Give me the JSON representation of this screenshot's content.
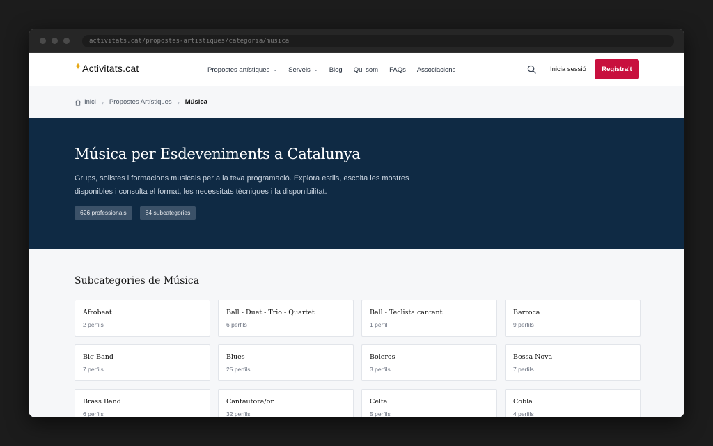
{
  "browser": {
    "url": "activitats.cat/propostes-artistiques/categoria/musica"
  },
  "nav": {
    "logo_text": "Activitats.cat",
    "items": [
      {
        "label": "Propostes artístiques",
        "dropdown": true
      },
      {
        "label": "Serveis",
        "dropdown": true
      },
      {
        "label": "Blog",
        "dropdown": false
      },
      {
        "label": "Qui som",
        "dropdown": false
      },
      {
        "label": "FAQs",
        "dropdown": false
      },
      {
        "label": "Associacions",
        "dropdown": false
      }
    ],
    "login_label": "Inicia sessió",
    "register_label": "Registra't",
    "register_color": "#c8103e"
  },
  "breadcrumb": {
    "home": "Inici",
    "parent": "Propostes Artístiques",
    "current": "Música"
  },
  "hero": {
    "title": "Música per Esdeveniments a Catalunya",
    "description": "Grups, solistes i formacions musicals per a la teva programació. Explora estils, escolta les mostres disponibles i consulta el format, les necessitats tècniques i la disponibilitat.",
    "badges": [
      "626 professionals",
      "84 subcategories"
    ],
    "background_color": "#0f2a44"
  },
  "subcategories": {
    "heading": "Subcategories de Música",
    "items": [
      {
        "name": "Afrobeat",
        "count": "2 perfils"
      },
      {
        "name": "Ball - Duet - Trio - Quartet",
        "count": "6 perfils"
      },
      {
        "name": "Ball - Teclista cantant",
        "count": "1 perfil"
      },
      {
        "name": "Barroca",
        "count": "9 perfils"
      },
      {
        "name": "Big Band",
        "count": "7 perfils"
      },
      {
        "name": "Blues",
        "count": "25 perfils"
      },
      {
        "name": "Boleros",
        "count": "3 perfils"
      },
      {
        "name": "Bossa Nova",
        "count": "7 perfils"
      },
      {
        "name": "Brass Band",
        "count": "6 perfils"
      },
      {
        "name": "Cantautora/or",
        "count": "32 perfils"
      },
      {
        "name": "Celta",
        "count": "5 perfils"
      },
      {
        "name": "Cobla",
        "count": "4 perfils"
      }
    ]
  }
}
